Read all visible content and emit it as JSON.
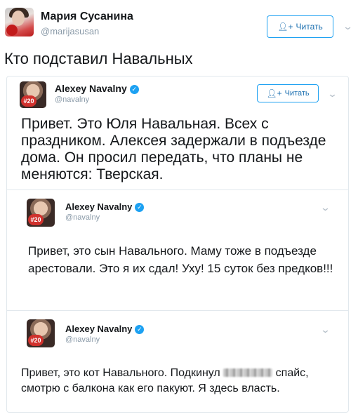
{
  "outer_tweet": {
    "author_name": "Мария Сусанина",
    "author_handle": "@marijasusan",
    "follow_label": "Читать",
    "text": "Кто подставил Навальных"
  },
  "quoted_tweet": {
    "author_name": "Alexey Navalny",
    "author_handle": "@navalny",
    "follow_label": "Читать",
    "avatar_badge": "#20",
    "text": "Привет. Это Юля Навальная. Всех с праздником. Алексея задержали в подъезде дома. Он просил передать, что планы не меняются: Тверская."
  },
  "reply_1": {
    "author_name": "Alexey Navalny",
    "author_handle": "@navalny",
    "avatar_badge": "#20",
    "text": "Привет, это сын Навального. Маму тоже в подъезде арестовали. Это я их сдал! Уху! 15 суток без предков!!!"
  },
  "reply_2": {
    "author_name": "Alexey Navalny",
    "author_handle": "@navalny",
    "avatar_badge": "#20",
    "text_before": "Привет, это кот Навального. Подкинул",
    "text_after": "спайс, смотрю с балкона как его пакуют. Я здесь власть."
  },
  "icons": {
    "chevron": "chevron-down-icon",
    "verified": "verified-badge-icon",
    "follow": "add-user-icon"
  },
  "colors": {
    "accent": "#1da1f2",
    "follow_text": "#1b6fb0",
    "muted": "#8a9aa8",
    "text": "#14171a",
    "badge": "#d0312d"
  }
}
